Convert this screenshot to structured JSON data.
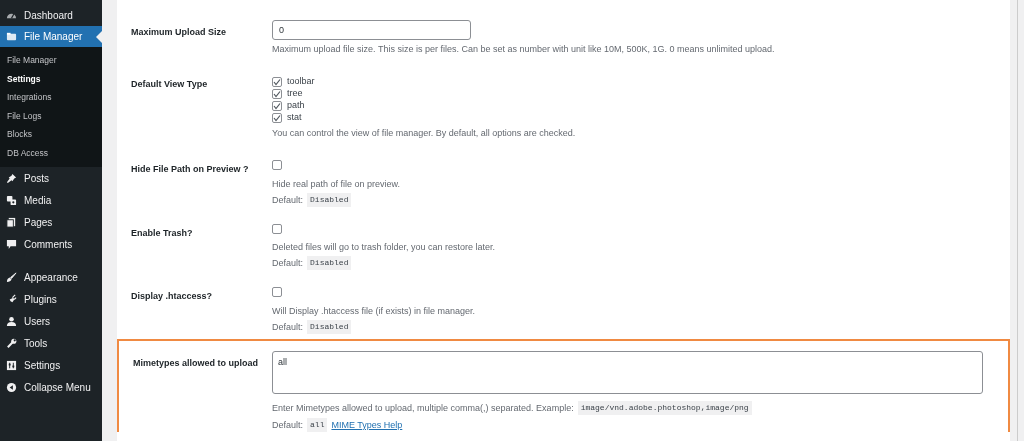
{
  "sidebar": {
    "items": [
      {
        "label": "Dashboard",
        "selected": false
      },
      {
        "label": "File Manager",
        "selected": true,
        "children": [
          {
            "label": "File Manager",
            "selected": false
          },
          {
            "label": "Settings",
            "selected": true
          },
          {
            "label": "Integrations",
            "selected": false
          },
          {
            "label": "File Logs",
            "selected": false
          },
          {
            "label": "Blocks",
            "selected": false
          },
          {
            "label": "DB Access",
            "selected": false
          }
        ]
      },
      {
        "label": "Posts",
        "selected": false
      },
      {
        "label": "Media",
        "selected": false
      },
      {
        "label": "Pages",
        "selected": false
      },
      {
        "label": "Comments",
        "selected": false
      },
      {
        "label": "Appearance",
        "selected": false,
        "gap": true
      },
      {
        "label": "Plugins",
        "selected": false
      },
      {
        "label": "Users",
        "selected": false
      },
      {
        "label": "Tools",
        "selected": false
      },
      {
        "label": "Settings",
        "selected": false
      },
      {
        "label": "Collapse Menu",
        "selected": false
      }
    ]
  },
  "settings": [
    {
      "kind": "input",
      "label": "Maximum Upload Size",
      "value": "0",
      "description": "Maximum upload file size. This size is per files. Can be set as number with unit like 10M, 500K, 1G. 0 means unlimited upload.",
      "highlighted": false
    },
    {
      "kind": "checkbox_group",
      "label": "Default View Type",
      "options": [
        {
          "label": "toolbar",
          "checked": true
        },
        {
          "label": "tree",
          "checked": true
        },
        {
          "label": "path",
          "checked": true
        },
        {
          "label": "stat",
          "checked": true
        }
      ],
      "description": "You can control the view of file manager. By default, all options are checked.",
      "highlighted": false
    },
    {
      "kind": "checkbox",
      "label": "Hide File Path on Preview ?",
      "checked": false,
      "description": "Hide real path of file on preview.",
      "default_label": "Default:",
      "default_value": "Disabled",
      "highlighted": false
    },
    {
      "kind": "checkbox",
      "label": "Enable Trash?",
      "checked": false,
      "description": "Deleted files will go to trash folder, you can restore later.",
      "default_label": "Default:",
      "default_value": "Disabled",
      "highlighted": false
    },
    {
      "kind": "checkbox",
      "label": "Display .htaccess?",
      "checked": false,
      "description": "Will Display .htaccess file (if exists) in file manager.",
      "default_label": "Default:",
      "default_value": "Disabled",
      "highlighted": false
    },
    {
      "kind": "textarea",
      "label": "Mimetypes allowed to upload",
      "value": "all",
      "description": "Enter Mimetypes allowed to upload, multiple comma(,) separated. Example:",
      "example": "image/vnd.adobe.photoshop,image/png",
      "default_label": "Default:",
      "default_value": "all",
      "link": "MIME Types Help",
      "highlighted": true
    }
  ]
}
